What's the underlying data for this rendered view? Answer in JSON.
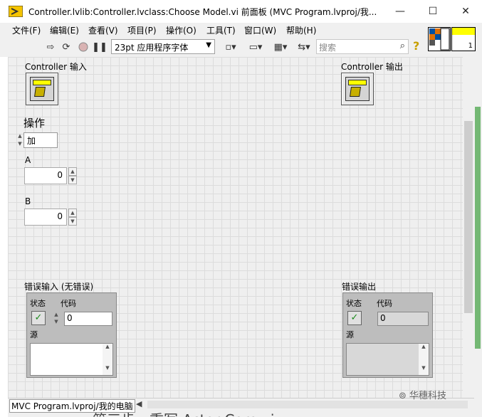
{
  "window": {
    "title": "Controller.lvlib:Controller.lvclass:Choose Model.vi 前面板 (MVC Program.lvproj/我...",
    "minimize": "—",
    "maximize": "☐",
    "close": "✕"
  },
  "menu": {
    "items": [
      "文件(F)",
      "编辑(E)",
      "查看(V)",
      "项目(P)",
      "操作(O)",
      "工具(T)",
      "窗口(W)",
      "帮助(H)"
    ]
  },
  "toolbar": {
    "font": "23pt 应用程序字体",
    "search_placeholder": "搜索",
    "help": "?",
    "connector_number": "1"
  },
  "panel": {
    "controller_in_label": "Controller 输入",
    "controller_out_label": "Controller 输出",
    "operation_label": "操作",
    "operation_value": "加",
    "a_label": "A",
    "a_value": "0",
    "b_label": "B",
    "b_value": "0",
    "error_in_label": "错误输入 (无错误)",
    "error_out_label": "错误输出",
    "status_label": "状态",
    "code_label": "代码",
    "source_label": "源",
    "error_in_code": "0",
    "error_out_code": "0"
  },
  "statusbar": {
    "project_path": "MVC Program.lvproj/我的电脑"
  },
  "watermark": "华穗科技",
  "below_text": "第三步，重写 Actor Core.vi"
}
